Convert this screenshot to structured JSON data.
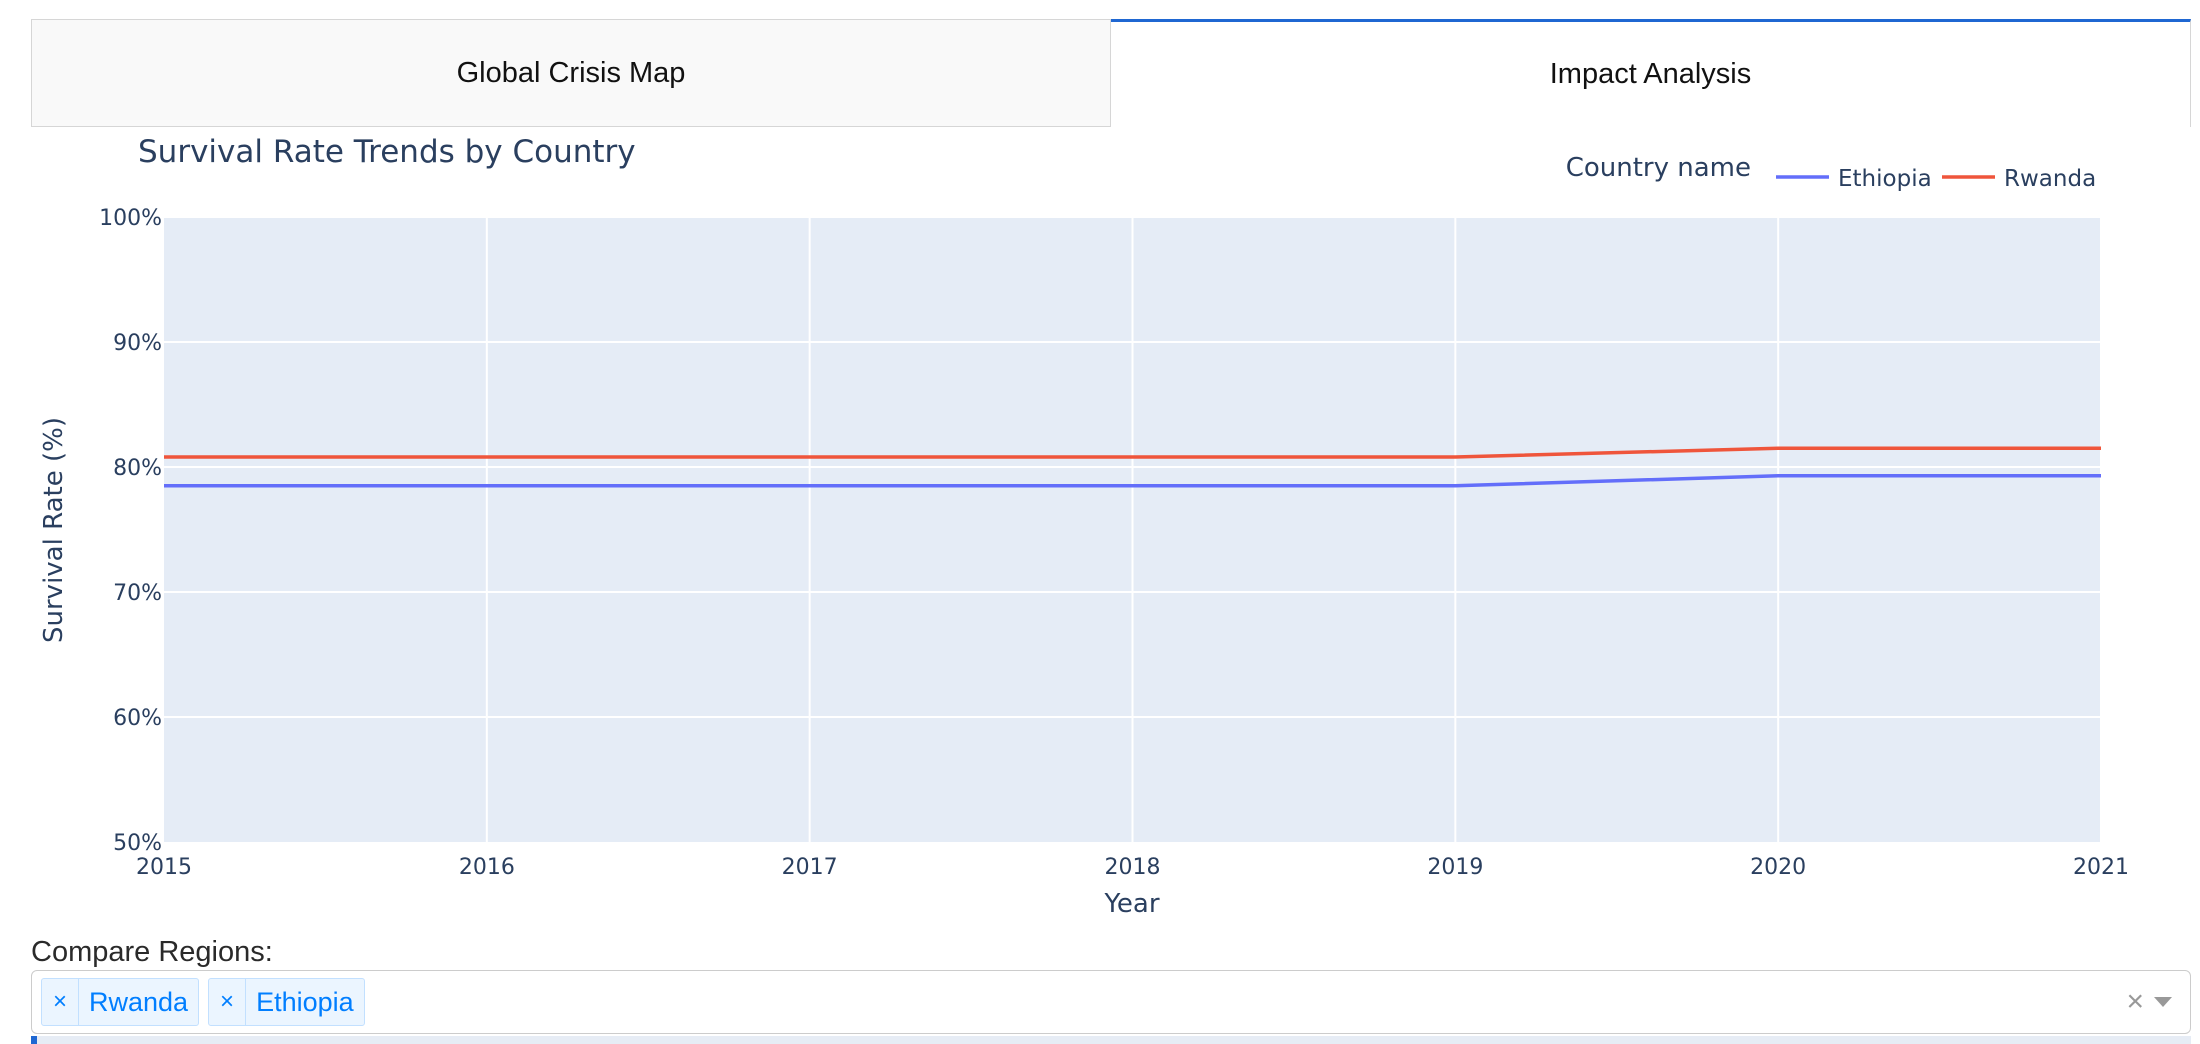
{
  "tabs": [
    {
      "label": "Global Crisis Map",
      "active": false
    },
    {
      "label": "Impact Analysis",
      "active": true
    }
  ],
  "chart_data": {
    "type": "line",
    "title": "Survival Rate Trends by Country",
    "xlabel": "Year",
    "ylabel": "Survival Rate (%)",
    "x": [
      2015,
      2016,
      2017,
      2018,
      2019,
      2020,
      2021
    ],
    "xlim": [
      2015,
      2021
    ],
    "ylim": [
      50,
      100
    ],
    "yticks": [
      "50%",
      "60%",
      "70%",
      "80%",
      "90%",
      "100%"
    ],
    "xticks": [
      "2015",
      "2016",
      "2017",
      "2018",
      "2019",
      "2020",
      "2021"
    ],
    "legend_title": "Country name",
    "legend_position": "top-right",
    "grid": true,
    "plot_background": "#e5ecf6",
    "series": [
      {
        "name": "Ethiopia",
        "color": "#636efa",
        "values": [
          78.5,
          78.5,
          78.5,
          78.5,
          78.5,
          79.3,
          79.3
        ]
      },
      {
        "name": "Rwanda",
        "color": "#ef553b",
        "values": [
          80.8,
          80.8,
          80.8,
          80.8,
          80.8,
          81.5,
          81.5
        ]
      }
    ]
  },
  "compare": {
    "label": "Compare Regions:",
    "selected": [
      "Rwanda",
      "Ethiopia"
    ],
    "remove_symbol": "×",
    "clear_symbol": "×"
  }
}
